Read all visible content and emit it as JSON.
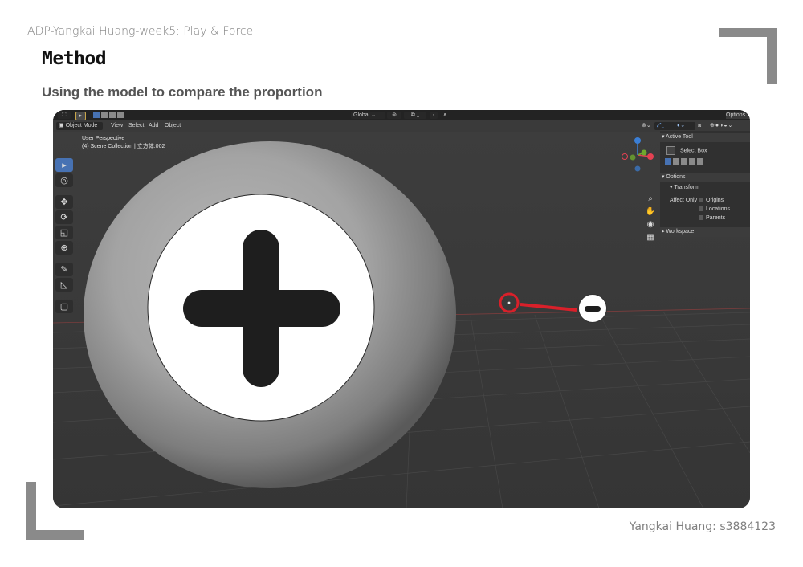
{
  "page": {
    "header": "ADP-Yangkai Huang-week5: Play & Force",
    "title": "Method",
    "subtitle": "Using the model to compare the proportion",
    "footer": "Yangkai Huang: s3884123"
  },
  "blender": {
    "topbar": {
      "orientation_label": "Global",
      "options_label": "Options"
    },
    "menubar": {
      "mode_label": "Object Mode",
      "menus": [
        "View",
        "Select",
        "Add",
        "Object"
      ]
    },
    "viewport": {
      "perspective_label": "User Perspective",
      "collection_label": "(4) Scene Collection | 立方体.002"
    },
    "npanel": {
      "active_tool_header": "Active Tool",
      "active_tool_name": "Select Box",
      "options_header": "Options",
      "transform_header": "Transform",
      "affect_only_label": "Affect Only",
      "affect_only_options": [
        "Origins",
        "Locations",
        "Parents"
      ],
      "workspace_header": "Workspace"
    },
    "gizmo": {
      "axes": [
        "X",
        "Y",
        "Z"
      ],
      "colors": {
        "x": "#e44152",
        "y": "#6ea82d",
        "z": "#3b7fd6"
      }
    },
    "tools": [
      "select-box",
      "cursor",
      "move",
      "rotate",
      "scale",
      "transform",
      "annotate",
      "measure",
      "add-cube"
    ]
  },
  "annotations": {
    "plus_label_color": "#ffffff",
    "minus_connector_color": "#d9202a"
  }
}
